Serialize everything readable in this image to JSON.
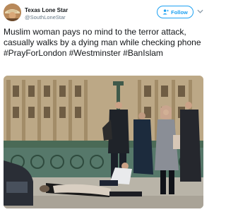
{
  "user": {
    "display_name": "Texas Lone Star",
    "handle": "@SouthLoneStar"
  },
  "follow_button": {
    "label": "Follow"
  },
  "tweet": {
    "text": "Muslim woman pays no mind to the terror attack, casually walks by a dying man while checking phone",
    "hashtags": [
      "#PrayForLondon",
      "#Westminster",
      "#BanIslam"
    ]
  },
  "colors": {
    "accent": "#1da1f2",
    "text": "#14171a",
    "muted": "#657786"
  },
  "icons": {
    "follow": "person-plus-icon",
    "more": "chevron-down-icon"
  }
}
